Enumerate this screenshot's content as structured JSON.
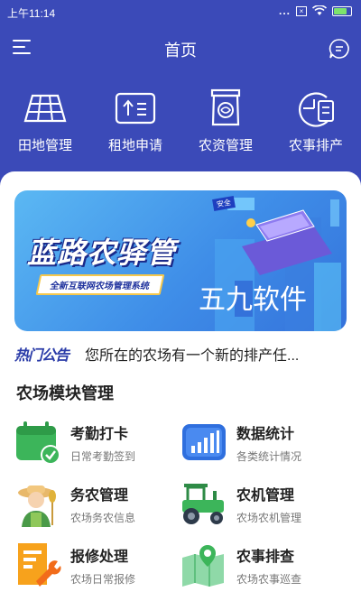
{
  "status_bar": {
    "time": "上午11:14",
    "dots": "...",
    "sim_label": "×",
    "battery_level": 0.8
  },
  "header": {
    "title": "首页"
  },
  "quick_nav": [
    {
      "label": "田地管理",
      "icon": "field-grid-icon"
    },
    {
      "label": "租地申请",
      "icon": "lease-upload-icon"
    },
    {
      "label": "农资管理",
      "icon": "supply-bag-icon"
    },
    {
      "label": "农事排产",
      "icon": "schedule-clock-icon"
    }
  ],
  "banner": {
    "brand": "蓝路农驿管",
    "tagline": "全新互联网农场管理系统",
    "watermark": "五九软件",
    "ribbon": "安全"
  },
  "notice": {
    "tag": "热门公告",
    "text": "您所在的农场有一个新的排产任..."
  },
  "modules_section": {
    "title": "农场模块管理"
  },
  "modules": [
    {
      "name": "考勤打卡",
      "desc": "日常考勤签到",
      "icon": "calendar-check-icon"
    },
    {
      "name": "数据统计",
      "desc": "各类统计情况",
      "icon": "bar-chart-icon"
    },
    {
      "name": "务农管理",
      "desc": "农场务农信息",
      "icon": "farmer-icon"
    },
    {
      "name": "农机管理",
      "desc": "农场农机管理",
      "icon": "tractor-icon"
    },
    {
      "name": "报修处理",
      "desc": "农场日常报修",
      "icon": "repair-wrench-icon"
    },
    {
      "name": "农事排查",
      "desc": "农场农事巡查",
      "icon": "map-pin-icon"
    }
  ],
  "colors": {
    "primary": "#3b4ab8",
    "accent_green": "#3cb55a",
    "text_dark": "#222222",
    "text_muted": "#777777"
  }
}
